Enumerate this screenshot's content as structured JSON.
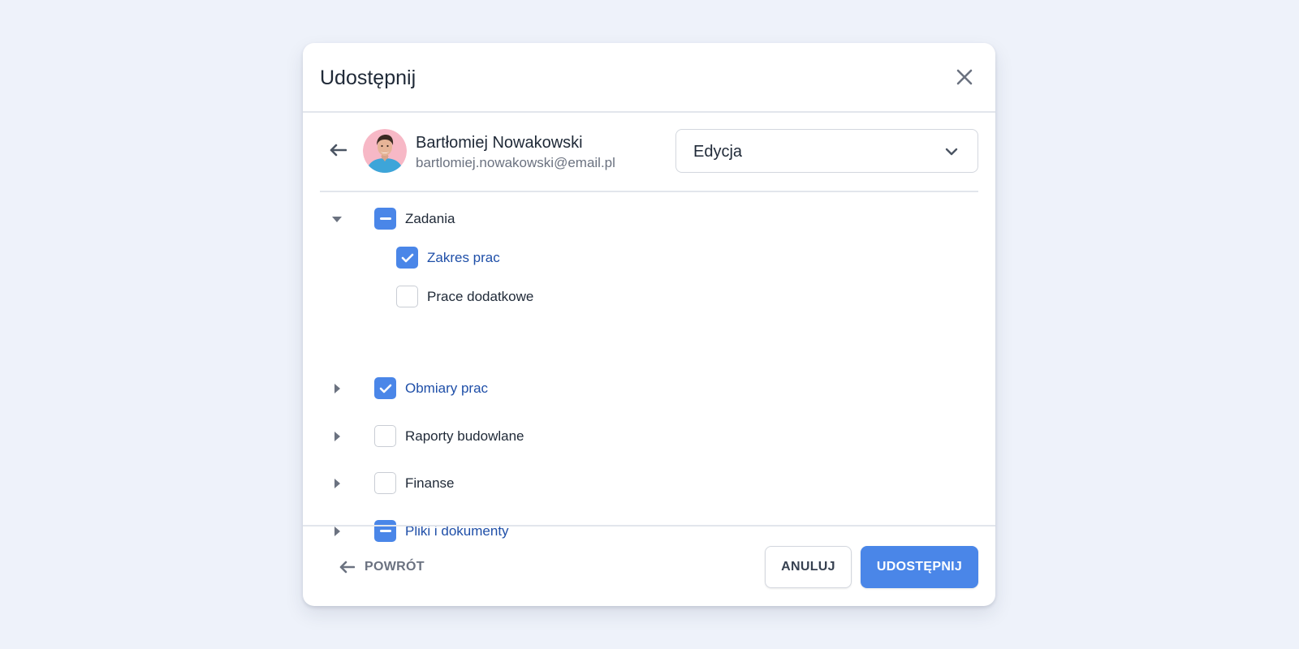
{
  "dialog": {
    "title": "Udostępnij"
  },
  "user": {
    "name": "Bartłomiej Nowakowski",
    "email": "bartlomiej.nowakowski@email.pl"
  },
  "role_select": {
    "selected": "Edycja"
  },
  "permissions": [
    {
      "label": "Zadania",
      "state": "partial",
      "expanded": true,
      "level": 0
    },
    {
      "label": "Zakres prac",
      "state": "checked",
      "level": 1
    },
    {
      "label": "Prace dodatkowe",
      "state": "unchecked",
      "level": 1
    },
    {
      "label": "Obmiary prac",
      "state": "checked",
      "expanded": false,
      "level": 0
    },
    {
      "label": "Raporty budowlane",
      "state": "unchecked",
      "expanded": false,
      "level": 0
    },
    {
      "label": "Finanse",
      "state": "unchecked",
      "expanded": false,
      "level": 0
    },
    {
      "label": "Pliki i dokumenty",
      "state": "partial",
      "expanded": false,
      "level": 0
    }
  ],
  "footer": {
    "back_label": "POWRÓT",
    "cancel_label": "ANULUJ",
    "share_label": "UDOSTĘPNIJ"
  },
  "colors": {
    "accent": "#4a86e8",
    "selected_text": "#1f4fa8",
    "background": "#eef2fa"
  },
  "icons": {
    "close": "close-icon",
    "back": "arrow-left-icon",
    "dropdown": "chevron-down-icon",
    "expand": "caret-right-icon",
    "collapse": "caret-down-icon"
  }
}
